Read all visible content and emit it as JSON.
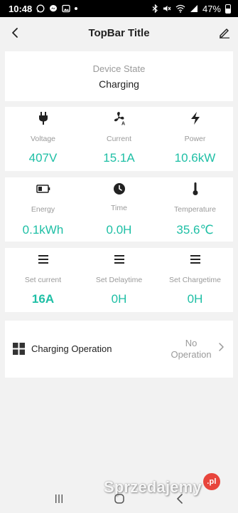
{
  "status_bar": {
    "time": "10:48",
    "battery_percent": "47%",
    "battery_level": 0.47,
    "left_icons": [
      "whatsapp-icon",
      "messenger-icon",
      "gallery-icon",
      "dot-icon"
    ],
    "right_icons": [
      "bluetooth-icon",
      "mute-icon",
      "wifi-icon",
      "signal-icon",
      "battery-icon"
    ]
  },
  "top_bar": {
    "title": "TopBar Title",
    "back_icon": "chevron-left-icon",
    "edit_icon": "pencil-icon"
  },
  "device_state": {
    "label": "Device State",
    "value": "Charging"
  },
  "metrics_row1": [
    {
      "icon": "plug-icon",
      "label": "Voltage",
      "value": "407V"
    },
    {
      "icon": "fan-current-icon",
      "label": "Current",
      "value": "15.1A"
    },
    {
      "icon": "lightning-icon",
      "label": "Power",
      "value": "10.6kW"
    }
  ],
  "metrics_row2": [
    {
      "icon": "battery-icon",
      "label": "Energy",
      "value": "0.1kWh"
    },
    {
      "icon": "clock-icon",
      "label": "Time",
      "value": "0.0H"
    },
    {
      "icon": "thermometer-icon",
      "label": "Temperature",
      "value": "35.6℃"
    }
  ],
  "settings_row": [
    {
      "icon": "menu-icon",
      "label": "Set current",
      "value": "16A"
    },
    {
      "icon": "menu-icon",
      "label": "Set Delaytime",
      "value": "0H"
    },
    {
      "icon": "menu-icon",
      "label": "Set Chargetime",
      "value": "0H"
    }
  ],
  "charging_operation": {
    "icon": "grid-icon",
    "label": "Charging Operation",
    "status_line1": "No",
    "status_line2": "Operation",
    "chevron_icon": "chevron-right-icon"
  },
  "nav_bar": {
    "items": [
      "recent-apps-icon",
      "home-icon",
      "back-icon"
    ]
  },
  "watermark": {
    "text": "Sprzedajemy",
    "badge": ".pl"
  },
  "colors": {
    "accent": "#1ebfa5",
    "label_gray": "#9a9a9a",
    "background": "#f2f2f2",
    "card": "#ffffff"
  }
}
